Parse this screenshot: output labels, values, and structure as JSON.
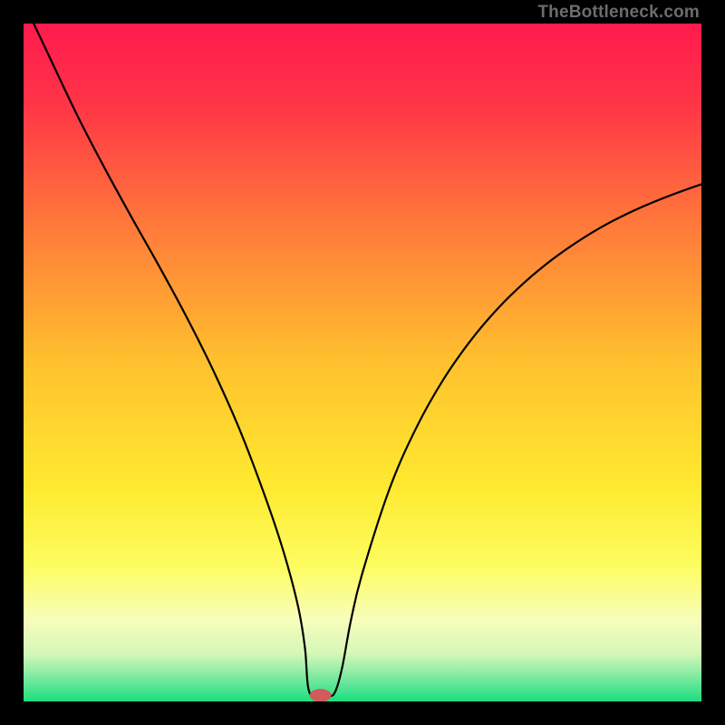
{
  "watermark": "TheBottleneck.com",
  "chart_data": {
    "type": "line",
    "title": "",
    "xlabel": "",
    "ylabel": "",
    "xlim": [
      0,
      100
    ],
    "ylim": [
      0,
      100
    ],
    "background_gradient": {
      "stops": [
        {
          "offset": 0.0,
          "color": "#ff1a4e"
        },
        {
          "offset": 0.12,
          "color": "#ff3547"
        },
        {
          "offset": 0.3,
          "color": "#ff7a3a"
        },
        {
          "offset": 0.5,
          "color": "#ffc12e"
        },
        {
          "offset": 0.68,
          "color": "#ffe92f"
        },
        {
          "offset": 0.8,
          "color": "#fdfd60"
        },
        {
          "offset": 0.88,
          "color": "#f8fdbb"
        },
        {
          "offset": 0.93,
          "color": "#d4f7b8"
        },
        {
          "offset": 0.965,
          "color": "#7be9a0"
        },
        {
          "offset": 1.0,
          "color": "#1bde7e"
        }
      ]
    },
    "series": [
      {
        "name": "bottleneck-curve",
        "x": [
          1.5,
          4,
          8,
          12,
          16,
          20,
          24,
          28,
          32,
          36,
          38.5,
          40.5,
          41.5,
          42.0,
          43.0,
          45.0,
          46.0,
          47.0,
          48.3,
          50,
          54,
          58,
          62,
          66,
          70,
          74,
          78,
          82,
          86,
          90,
          94,
          98,
          100
        ],
        "y": [
          100,
          94.7,
          86.3,
          78.6,
          71.3,
          64.2,
          56.8,
          48.8,
          39.8,
          29.2,
          21.6,
          14.0,
          8.0,
          2.0,
          0.7,
          0.7,
          1.5,
          5.0,
          12.0,
          19.0,
          31.4,
          40.5,
          47.6,
          53.3,
          58.0,
          61.9,
          65.2,
          68.0,
          70.4,
          72.4,
          74.1,
          75.6,
          76.3
        ]
      }
    ],
    "marker": {
      "x": 43.8,
      "y": 0.9,
      "rx": 1.6,
      "ry": 0.95,
      "color": "#d15a5a"
    }
  }
}
